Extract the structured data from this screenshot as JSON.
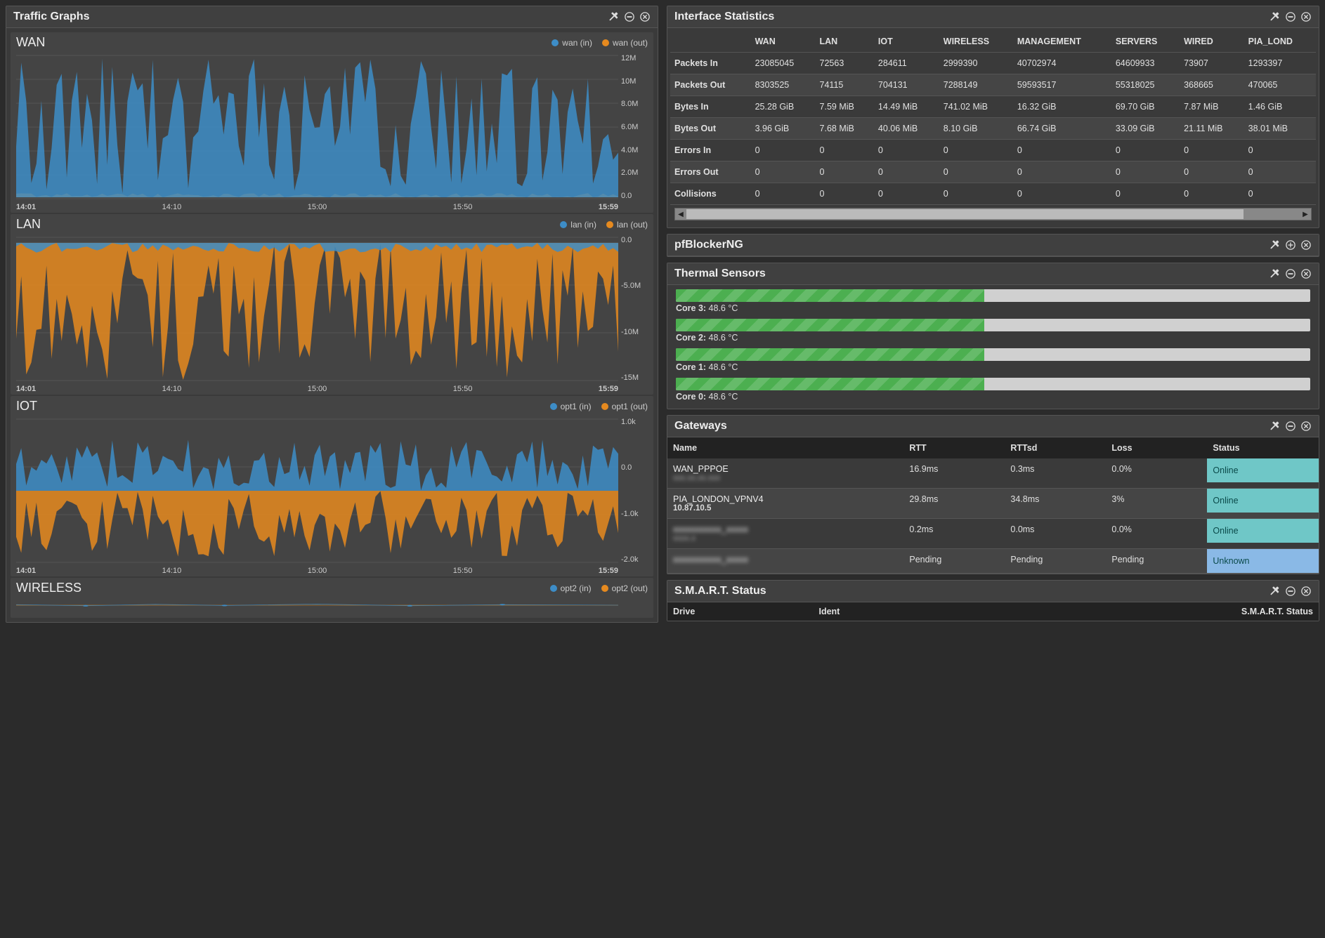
{
  "panels": {
    "traffic_title": "Traffic Graphs",
    "ifstats_title": "Interface Statistics",
    "pfblocker_title": "pfBlockerNG",
    "thermal_title": "Thermal Sensors",
    "gateways_title": "Gateways",
    "smart_title": "S.M.A.R.T. Status"
  },
  "graphs": [
    {
      "name": "WAN",
      "in_label": "wan (in)",
      "out_label": "wan (out)",
      "yticks": [
        "12M",
        "10M",
        "8.0M",
        "6.0M",
        "4.0M",
        "2.0M",
        "0.0"
      ],
      "xticks": [
        "14:01",
        "14:10",
        "15:00",
        "15:50",
        "15:59"
      ]
    },
    {
      "name": "LAN",
      "in_label": "lan (in)",
      "out_label": "lan (out)",
      "yticks": [
        "0.0",
        "-5.0M",
        "-10M",
        "-15M"
      ],
      "xticks": [
        "14:01",
        "14:10",
        "15:00",
        "15:50",
        "15:59"
      ]
    },
    {
      "name": "IOT",
      "in_label": "opt1 (in)",
      "out_label": "opt1 (out)",
      "yticks": [
        "1.0k",
        "0.0",
        "-1.0k",
        "-2.0k"
      ],
      "xticks": [
        "14:01",
        "14:10",
        "15:00",
        "15:50",
        "15:59"
      ]
    },
    {
      "name": "WIRELESS",
      "in_label": "opt2 (in)",
      "out_label": "opt2 (out)",
      "yticks": [],
      "xticks": []
    }
  ],
  "ifstats": {
    "columns": [
      "",
      "WAN",
      "LAN",
      "IOT",
      "WIRELESS",
      "MANAGEMENT",
      "SERVERS",
      "WIRED",
      "PIA_LOND"
    ],
    "rows": [
      [
        "Packets In",
        "23085045",
        "72563",
        "284611",
        "2999390",
        "40702974",
        "64609933",
        "73907",
        "1293397"
      ],
      [
        "Packets Out",
        "8303525",
        "74115",
        "704131",
        "7288149",
        "59593517",
        "55318025",
        "368665",
        "470065"
      ],
      [
        "Bytes In",
        "25.28 GiB",
        "7.59 MiB",
        "14.49 MiB",
        "741.02 MiB",
        "16.32 GiB",
        "69.70 GiB",
        "7.87 MiB",
        "1.46 GiB"
      ],
      [
        "Bytes Out",
        "3.96 GiB",
        "7.68 MiB",
        "40.06 MiB",
        "8.10 GiB",
        "66.74 GiB",
        "33.09 GiB",
        "21.11 MiB",
        "38.01 MiB"
      ],
      [
        "Errors In",
        "0",
        "0",
        "0",
        "0",
        "0",
        "0",
        "0",
        "0"
      ],
      [
        "Errors Out",
        "0",
        "0",
        "0",
        "0",
        "0",
        "0",
        "0",
        "0"
      ],
      [
        "Collisions",
        "0",
        "0",
        "0",
        "0",
        "0",
        "0",
        "0",
        "0"
      ]
    ]
  },
  "thermal": [
    {
      "label": "Core 3:",
      "value": "48.6 °C",
      "pct": 48.6
    },
    {
      "label": "Core 2:",
      "value": "48.6 °C",
      "pct": 48.6
    },
    {
      "label": "Core 1:",
      "value": "48.6 °C",
      "pct": 48.6
    },
    {
      "label": "Core 0:",
      "value": "48.6 °C",
      "pct": 48.6
    }
  ],
  "gateways": {
    "columns": [
      "Name",
      "RTT",
      "RTTsd",
      "Loss",
      "Status"
    ],
    "rows": [
      {
        "name": "WAN_PPPOE",
        "sub": "xxx.xx.xx.xxx",
        "sub_clear": false,
        "rtt": "16.9ms",
        "rttsd": "0.3ms",
        "loss": "0.0%",
        "status": "Online",
        "status_class": "status-online"
      },
      {
        "name": "PIA_LONDON_VPNV4",
        "sub": "10.87.10.5",
        "sub_clear": true,
        "rtt": "29.8ms",
        "rttsd": "34.8ms",
        "loss": "3%",
        "status": "Online",
        "status_class": "status-online"
      },
      {
        "name": "xxxxxxxxxxx_xxxxx",
        "sub": "xxxx.x",
        "sub_clear": false,
        "rtt": "0.2ms",
        "rttsd": "0.0ms",
        "loss": "0.0%",
        "status": "Online",
        "status_class": "status-online"
      },
      {
        "name": "xxxxxxxxxxx_xxxxx",
        "sub": "",
        "sub_clear": false,
        "rtt": "Pending",
        "rttsd": "Pending",
        "loss": "Pending",
        "status": "Unknown",
        "status_class": "status-unknown"
      }
    ]
  },
  "smart": {
    "columns": [
      "Drive",
      "Ident",
      "S.M.A.R.T. Status"
    ]
  },
  "chart_data": [
    {
      "type": "area",
      "title": "WAN",
      "series": [
        {
          "name": "wan (in)",
          "color": "#3d8dc7"
        },
        {
          "name": "wan (out)",
          "color": "#e68a1f"
        }
      ],
      "ylim": [
        0,
        12000000
      ],
      "xrange": [
        "14:01",
        "15:59"
      ],
      "yticks": [
        0,
        2000000,
        4000000,
        6000000,
        8000000,
        10000000,
        12000000
      ]
    },
    {
      "type": "area",
      "title": "LAN",
      "series": [
        {
          "name": "lan (in)",
          "color": "#3d8dc7"
        },
        {
          "name": "lan (out)",
          "color": "#e68a1f"
        }
      ],
      "ylim": [
        -17000000,
        1000000
      ],
      "xrange": [
        "14:01",
        "15:59"
      ],
      "yticks": [
        0,
        -5000000,
        -10000000,
        -15000000
      ]
    },
    {
      "type": "area",
      "title": "IOT",
      "series": [
        {
          "name": "opt1 (in)",
          "color": "#3d8dc7"
        },
        {
          "name": "opt1 (out)",
          "color": "#e68a1f"
        }
      ],
      "ylim": [
        -2000,
        1500
      ],
      "xrange": [
        "14:01",
        "15:59"
      ],
      "yticks": [
        1000,
        0,
        -1000,
        -2000
      ]
    },
    {
      "type": "area",
      "title": "WIRELESS",
      "series": [
        {
          "name": "opt2 (in)",
          "color": "#3d8dc7"
        },
        {
          "name": "opt2 (out)",
          "color": "#e68a1f"
        }
      ]
    }
  ]
}
